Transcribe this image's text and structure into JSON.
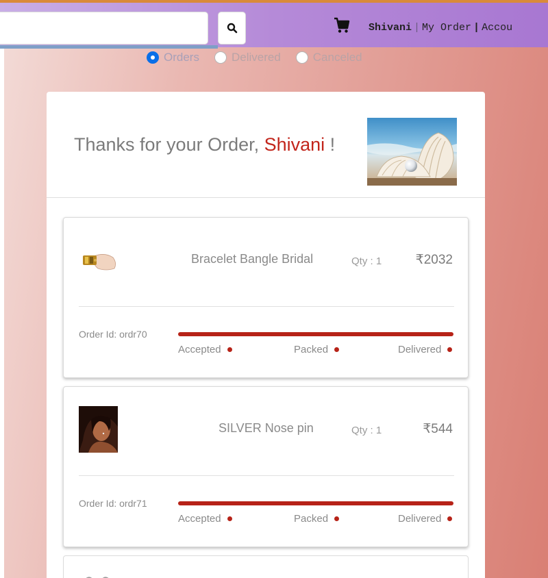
{
  "colors": {
    "accent": "#c2261c",
    "progress": "#b72318",
    "nav_start": "#c9aee6",
    "nav_end": "#a877d2",
    "radio_checked": "#0a6fe8"
  },
  "navbar": {
    "search_placeholder": "",
    "search_icon": "search-icon",
    "cart_icon": "cart-icon",
    "user_name": "Shivani",
    "sep1": "|",
    "my_order": "My Order",
    "sep2": "|",
    "account": "Accou"
  },
  "filters": [
    {
      "label": "Orders",
      "checked": true
    },
    {
      "label": "Delivered",
      "checked": false
    },
    {
      "label": "Canceled",
      "checked": false
    }
  ],
  "header": {
    "prefix": "Thanks for your Order, ",
    "name": "Shivani",
    "suffix": " !"
  },
  "orders": [
    {
      "product": "Bracelet Bangle Bridal",
      "qty": "Qty : 1",
      "price": "₹2032",
      "order_id": "Order Id: ordr70",
      "steps": [
        "Accepted",
        "Packed",
        "Delivered"
      ]
    },
    {
      "product": "SILVER Nose pin",
      "qty": "Qty : 1",
      "price": "₹544",
      "order_id": "Order Id: ordr71",
      "steps": [
        "Accepted",
        "Packed",
        "Delivered"
      ]
    }
  ]
}
